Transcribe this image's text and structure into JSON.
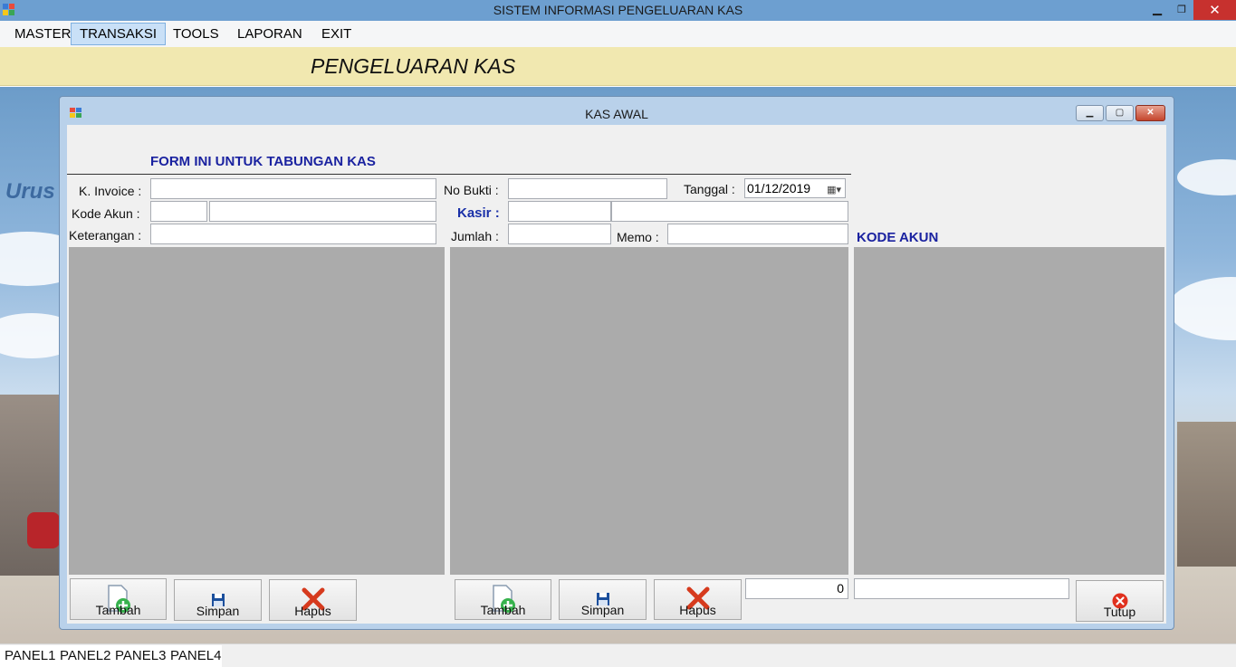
{
  "window": {
    "title": "SISTEM INFORMASI PENGELUARAN KAS"
  },
  "menu": [
    {
      "label": "MASTER"
    },
    {
      "label": "TRANSAKSI",
      "active": true
    },
    {
      "label": "TOOLS"
    },
    {
      "label": "LAPORAN"
    },
    {
      "label": "EXIT"
    }
  ],
  "header": {
    "title": "PENGELUARAN KAS"
  },
  "background": {
    "logo_text": "Urus"
  },
  "child_form": {
    "title": "KAS AWAL",
    "heading": "FORM INI UNTUK TABUNGAN  KAS",
    "kode_akun_heading": "KODE AKUN",
    "labels": {
      "invoice": "K. Invoice :",
      "kode_akun": "Kode Akun :",
      "keterangan": "Keterangan :",
      "no_bukti": "No Bukti :",
      "kasir": "Kasir :",
      "jumlah": "Jumlah :",
      "tanggal": "Tanggal :",
      "memo": "Memo :"
    },
    "fields": {
      "invoice": "",
      "kode_akun_code": "",
      "kode_akun_name": "",
      "keterangan": "",
      "no_bukti": "",
      "kasir_code": "",
      "kasir_name": "",
      "jumlah": "",
      "memo": "",
      "tanggal": "01/12/2019",
      "total": "0",
      "kode_akun_search": ""
    },
    "buttons": {
      "tambah": "Tambah",
      "simpan": "Simpan",
      "hapus": "Hapus",
      "tutup": "Tutup"
    }
  },
  "statusbar": [
    "PANEL1",
    "PANEL2",
    "PANEL3",
    "PANEL4"
  ],
  "icons": {
    "app": "app-window-icon",
    "tambah": "add-document-icon",
    "simpan": "floppy-disk-icon",
    "hapus": "red-x-icon",
    "tutup": "red-close-circle-icon"
  }
}
